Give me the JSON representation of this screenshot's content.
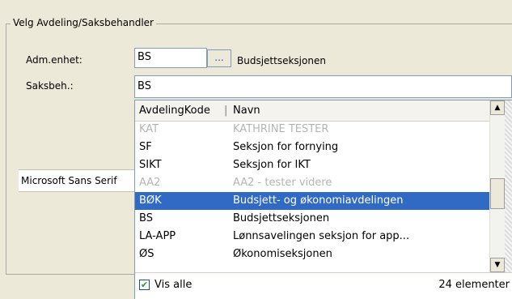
{
  "group": {
    "title": "Velg Avdeling/Saksbehandler"
  },
  "adm": {
    "label": "Adm.enhet:",
    "code": "BS",
    "browse_label": "...",
    "name": "Budsjettseksjonen"
  },
  "saksbeh": {
    "label": "Saksbeh.:",
    "value": "BS"
  },
  "font_field": {
    "value": "Microsoft Sans Serif"
  },
  "dropdown": {
    "headers": {
      "code": "AvdelingKode",
      "separator": "|",
      "name": "Navn"
    },
    "rows": [
      {
        "code": "KAT",
        "name": "KATHRINE TESTER",
        "state": "disabled"
      },
      {
        "code": "SF",
        "name": "Seksjon for fornying",
        "state": "normal"
      },
      {
        "code": "SIKT",
        "name": "Seksjon for IKT",
        "state": "normal"
      },
      {
        "code": "AA2",
        "name": "AA2 - tester videre",
        "state": "disabled"
      },
      {
        "code": "BØK",
        "name": "Budsjett- og økonomiavdelingen",
        "state": "selected"
      },
      {
        "code": "BS",
        "name": "Budsjettseksjonen",
        "state": "normal"
      },
      {
        "code": "LA-APP",
        "name": "Lønnsavelingen seksjon for app...",
        "state": "normal"
      },
      {
        "code": "ØS",
        "name": "Økonomiseksjonen",
        "state": "normal"
      }
    ],
    "scroll_up": "▲",
    "scroll_down": "▼",
    "footer": {
      "checkbox_mark": "✔",
      "show_all_label": "Vis alle",
      "count_text": "24 elementer",
      "show_all_checked": true
    }
  }
}
